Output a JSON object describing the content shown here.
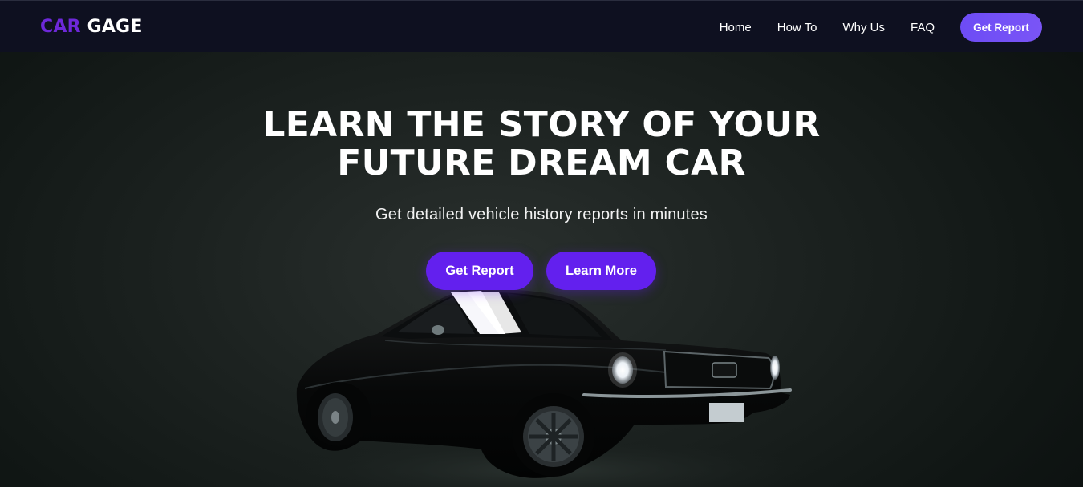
{
  "brand": {
    "part1": "CAR",
    "part2": "GAGE",
    "accent_color": "#6d28d9"
  },
  "nav": {
    "items": [
      {
        "label": "Home"
      },
      {
        "label": "How To"
      },
      {
        "label": "Why Us"
      },
      {
        "label": "FAQ"
      }
    ],
    "cta_label": "Get Report"
  },
  "hero": {
    "title_line1": "LEARN THE STORY OF YOUR",
    "title_line2": "FUTURE DREAM CAR",
    "subtitle": "Get detailed vehicle history reports in minutes",
    "primary_button": "Get Report",
    "secondary_button": "Learn More",
    "button_color": "#6320ee"
  },
  "image": {
    "icon": "black-muscle-car-image"
  }
}
